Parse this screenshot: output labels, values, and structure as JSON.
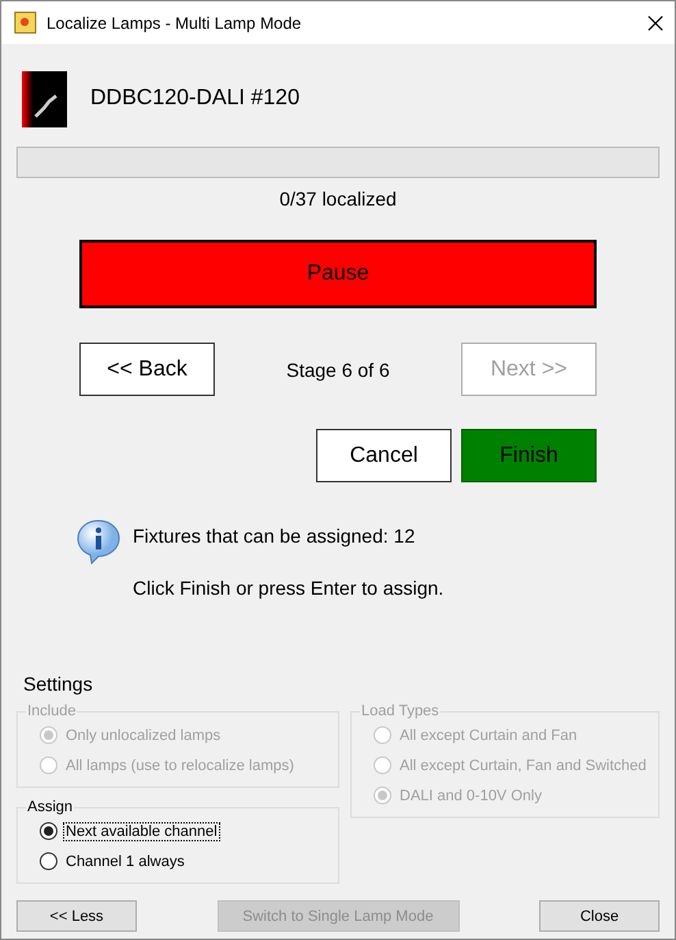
{
  "window": {
    "title": "Localize Lamps - Multi Lamp Mode"
  },
  "device": {
    "name": "DDBC120-DALI #120"
  },
  "progress": {
    "level": 0,
    "text": "0/37 localized"
  },
  "pause_button": {
    "label": "Pause"
  },
  "navigation": {
    "back": {
      "label": "<< Back",
      "disabled": false
    },
    "stage": "Stage 6 of 6",
    "next": {
      "label": "Next >>",
      "disabled": true
    }
  },
  "actions": [
    {
      "kind": "plain",
      "label": "Cancel"
    },
    {
      "kind": "primary",
      "label": "Finish"
    }
  ],
  "info": {
    "lines": [
      "Fixtures that can be assigned: 12",
      "Click Finish or press Enter to assign."
    ]
  },
  "settings": {
    "title": "Settings",
    "groups": [
      {
        "title": "Include",
        "disabled": true,
        "options": [
          {
            "label": "Only unlocalized lamps",
            "selected": true,
            "focused": false
          },
          {
            "label": "All lamps (use to relocalize lamps)",
            "selected": false,
            "focused": false
          }
        ]
      },
      {
        "title": "Load Types",
        "disabled": true,
        "options": [
          {
            "label": "All except Curtain and Fan",
            "selected": false,
            "focused": false
          },
          {
            "label": "All except Curtain, Fan and Switched",
            "selected": false,
            "focused": false
          },
          {
            "label": "DALI and 0-10V Only",
            "selected": true,
            "focused": false
          }
        ]
      },
      {
        "title": "Assign",
        "disabled": false,
        "options": [
          {
            "label": "Next available channel",
            "selected": true,
            "focused": true
          },
          {
            "label": "Channel 1 always",
            "selected": false,
            "focused": false
          }
        ]
      }
    ]
  },
  "footer_buttons": [
    {
      "label": "<< Less",
      "disabled": false
    },
    {
      "label": "Switch to Single Lamp Mode",
      "disabled": true
    },
    {
      "label": "Close",
      "disabled": false
    }
  ]
}
